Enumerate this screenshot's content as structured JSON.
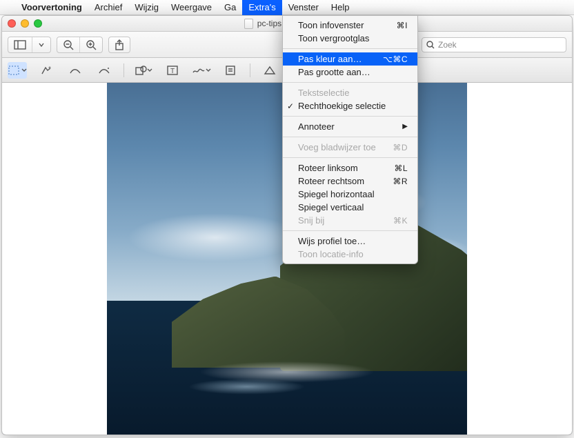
{
  "menubar": {
    "app": "Voorvertoning",
    "items": [
      "Archief",
      "Wijzig",
      "Weergave",
      "Ga",
      "Extra's",
      "Venster",
      "Help"
    ],
    "active_index": 4
  },
  "window": {
    "title": "pc-tips.info voorbeel"
  },
  "toolbar": {
    "search_placeholder": "Zoek"
  },
  "dropdown": {
    "groups": [
      [
        {
          "label": "Toon infovenster",
          "shortcut": "⌘I",
          "disabled": false
        },
        {
          "label": "Toon vergrootglas",
          "shortcut": "",
          "disabled": false
        }
      ],
      [
        {
          "label": "Pas kleur aan…",
          "shortcut": "⌥⌘C",
          "highlight": true
        },
        {
          "label": "Pas grootte aan…",
          "shortcut": ""
        }
      ],
      [
        {
          "label": "Tekstselectie",
          "shortcut": "",
          "disabled": true
        },
        {
          "label": "Rechthoekige selectie",
          "shortcut": "",
          "checked": true
        }
      ],
      [
        {
          "label": "Annoteer",
          "shortcut": "",
          "submenu": true
        }
      ],
      [
        {
          "label": "Voeg bladwijzer toe",
          "shortcut": "⌘D",
          "disabled": true
        }
      ],
      [
        {
          "label": "Roteer linksom",
          "shortcut": "⌘L"
        },
        {
          "label": "Roteer rechtsom",
          "shortcut": "⌘R"
        },
        {
          "label": "Spiegel horizontaal",
          "shortcut": ""
        },
        {
          "label": "Spiegel verticaal",
          "shortcut": ""
        },
        {
          "label": "Snij bij",
          "shortcut": "⌘K",
          "disabled": true
        }
      ],
      [
        {
          "label": "Wijs profiel toe…",
          "shortcut": ""
        },
        {
          "label": "Toon locatie-info",
          "shortcut": "",
          "disabled": true
        }
      ]
    ]
  }
}
